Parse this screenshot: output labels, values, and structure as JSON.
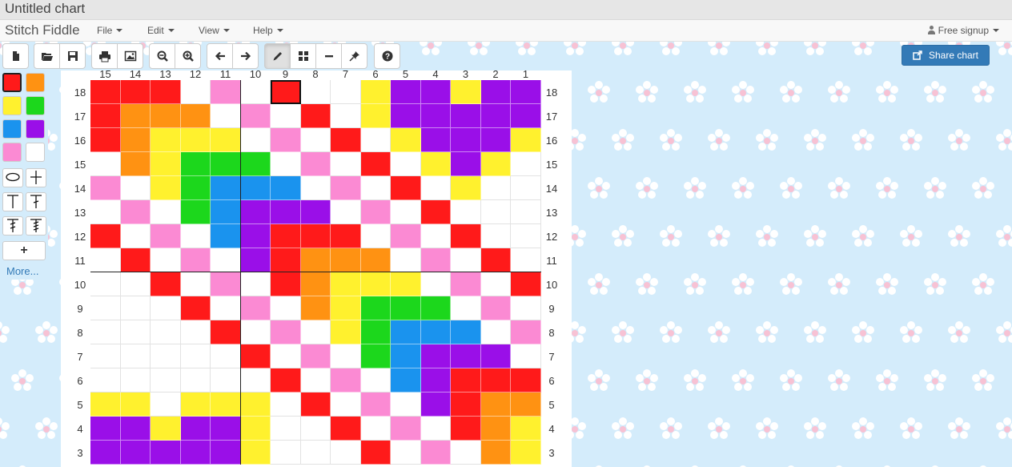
{
  "title": "Untitled chart",
  "brand": "Stitch Fiddle",
  "menus": [
    {
      "label": "File"
    },
    {
      "label": "Edit"
    },
    {
      "label": "View"
    },
    {
      "label": "Help"
    }
  ],
  "user_menu": "Free signup",
  "share_label": "Share chart",
  "toolbar_groups": [
    [
      "new-file-icon"
    ],
    [
      "open-folder-icon",
      "save-icon"
    ],
    [
      "print-icon",
      "image-icon"
    ],
    [
      "zoom-out-icon",
      "zoom-in-icon"
    ],
    [
      "arrow-left-icon",
      "arrow-right-icon"
    ],
    [
      "pencil-icon",
      "grid-icon",
      "minus-icon",
      "pin-icon"
    ],
    [
      "help-icon"
    ]
  ],
  "active_tool": "pencil-icon",
  "palette": {
    "colors": [
      "#ff1a1a",
      "#ff9212",
      "#fff12e",
      "#1cd71c",
      "#1a93ee",
      "#9a0fe8",
      "#fb8ad3",
      "#ffffff"
    ],
    "selected_index": 0,
    "symbols": [
      "oval-symbol-icon",
      "plus-symbol-icon",
      "t-symbol-icon",
      "t-tick-symbol-icon",
      "t-double-tick-symbol-icon",
      "t-triple-tick-symbol-icon"
    ],
    "add_label": "+",
    "more_label": "More..."
  },
  "chart": {
    "columns": [
      "15",
      "14",
      "13",
      "12",
      "11",
      "10",
      "9",
      "8",
      "7",
      "6",
      "5",
      "4",
      "3",
      "2",
      "1"
    ],
    "rows": [
      "18",
      "17",
      "16",
      "15",
      "14",
      "13",
      "12",
      "11",
      "10",
      "9",
      "8",
      "7",
      "6",
      "5",
      "4",
      "3"
    ],
    "legend": {
      "R": "#ff1a1a",
      "O": "#ff9212",
      "Y": "#fff12e",
      "G": "#1cd71c",
      "B": "#1a93ee",
      "P": "#9a0fe8",
      "K": "#fb8ad3",
      "W": "#ffffff"
    },
    "cells": [
      "RRRWKWRWWYPPYPP",
      "ROOOWKWRWYPPPPP",
      "ROYYYWKWRWYPPPY",
      "WOYGGGWKWRWYPYW",
      "KWYGBBBWKWRWYWW",
      "WKWGBPPPWKWRWWW",
      "RWKWBPRRRWKWRWW",
      "WRWKWPROOOWKWRW",
      "WWRWKWROYYYWKWR",
      "WWWRWKWOYGGGWKW",
      "WWWWRWKWYGBBBWK",
      "WWWWWRWKWGBPPPW",
      "WWWWWWRWKWBPRRR",
      "YYWYYYWRWKWPROO",
      "PPYPPYWWRWKWROY",
      "PPPPPYWWWRWKWOY"
    ],
    "highlight_cell": "18-9"
  }
}
